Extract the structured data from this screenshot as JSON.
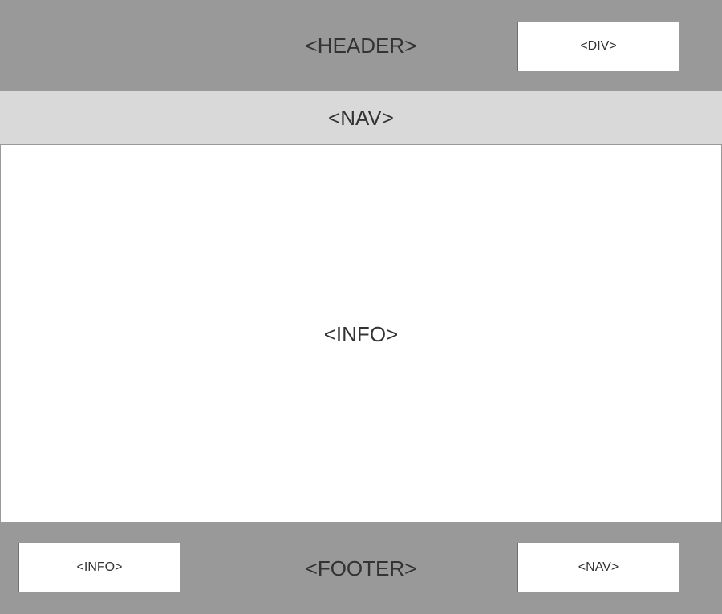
{
  "header": {
    "label": "<HEADER>",
    "div_box_label": "<DIV>"
  },
  "nav": {
    "label": "<NAV>"
  },
  "main": {
    "label": "<INFO>"
  },
  "footer": {
    "label": "<FOOTER>",
    "info_box_label": "<INFO>",
    "nav_box_label": "<NAV>"
  },
  "colors": {
    "header_footer_bg": "#999999",
    "nav_bg": "#d9d9d9",
    "content_bg": "#ffffff",
    "text": "#333333"
  }
}
